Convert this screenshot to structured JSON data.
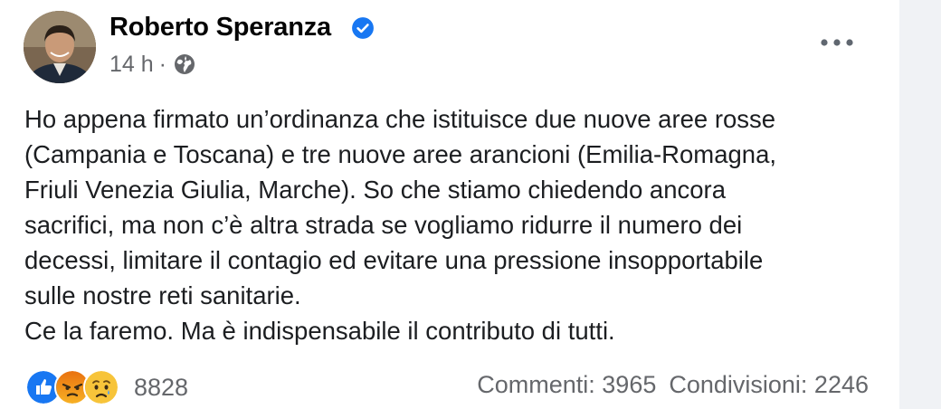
{
  "post": {
    "author": "Roberto Speranza",
    "timestamp": "14 h",
    "separator": "·",
    "audience_icon": "globe-icon",
    "verified_icon": "verified-badge-icon",
    "more_icon": "more-options-icon",
    "body_lines": [
      "Ho appena firmato un’ordinanza che istituisce due nuove aree rosse",
      "(Campania e Toscana) e tre nuove aree arancioni (Emilia-Romagna,",
      "Friuli Venezia Giulia, Marche). So che stiamo chiedendo ancora",
      "sacrifici, ma non c’è altra strada se vogliamo ridurre il numero dei",
      "decessi, limitare il contagio ed evitare una pressione insopportabile",
      "sulle nostre reti sanitarie.",
      "Ce la faremo. Ma è indispensabile il contributo di tutti."
    ]
  },
  "footer": {
    "reaction_icons": [
      "like-reaction-icon",
      "angry-reaction-icon",
      "sad-reaction-icon"
    ],
    "reaction_count": "8828",
    "comments": "Commenti: 3965",
    "shares": "Condivisioni: 2246"
  },
  "colors": {
    "verified_blue": "#1877f2",
    "secondary_text": "#65676b",
    "page_bg": "#f0f2f5"
  }
}
